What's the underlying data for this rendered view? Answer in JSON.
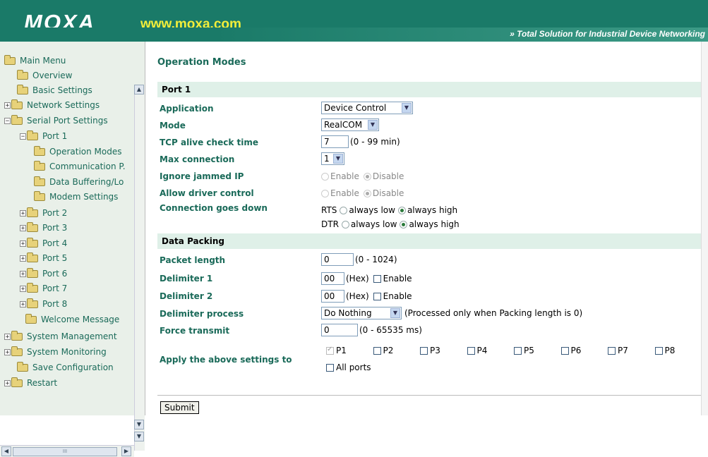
{
  "header": {
    "logo": "MOXA",
    "site": "www.moxa.com",
    "slogan": "» Total Solution for Industrial Device Networking"
  },
  "tree": {
    "items": [
      {
        "label": "Main Menu",
        "icon": "folder-open-icon",
        "expander": ""
      },
      {
        "label": "Overview",
        "icon": "folder-icon",
        "expander": ""
      },
      {
        "label": "Basic Settings",
        "icon": "folder-icon",
        "expander": ""
      },
      {
        "label": "Network Settings",
        "icon": "folder-icon",
        "expander": "+"
      },
      {
        "label": "Serial Port Settings",
        "icon": "folder-open-icon",
        "expander": "−"
      },
      {
        "label": "Port 1",
        "icon": "folder-open-icon",
        "expander": "−"
      },
      {
        "label": "Operation Modes",
        "icon": "folder-icon",
        "expander": ""
      },
      {
        "label": "Communication P.",
        "icon": "folder-icon",
        "expander": ""
      },
      {
        "label": "Data Buffering/Lo",
        "icon": "folder-icon",
        "expander": ""
      },
      {
        "label": "Modem Settings",
        "icon": "folder-icon",
        "expander": ""
      },
      {
        "label": "Port 2",
        "icon": "folder-icon",
        "expander": "+"
      },
      {
        "label": "Port 3",
        "icon": "folder-icon",
        "expander": "+"
      },
      {
        "label": "Port 4",
        "icon": "folder-icon",
        "expander": "+"
      },
      {
        "label": "Port 5",
        "icon": "folder-icon",
        "expander": "+"
      },
      {
        "label": "Port 6",
        "icon": "folder-icon",
        "expander": "+"
      },
      {
        "label": "Port 7",
        "icon": "folder-icon",
        "expander": "+"
      },
      {
        "label": "Port 8",
        "icon": "folder-icon",
        "expander": "+"
      },
      {
        "label": "Welcome Message",
        "icon": "folder-icon",
        "expander": ""
      },
      {
        "label": "System Management",
        "icon": "folder-icon",
        "expander": "+"
      },
      {
        "label": "System Monitoring",
        "icon": "folder-icon",
        "expander": "+"
      },
      {
        "label": "Save Configuration",
        "icon": "folder-icon",
        "expander": ""
      },
      {
        "label": "Restart",
        "icon": "folder-icon",
        "expander": "+"
      }
    ],
    "scroll_thumb_glyph": "III"
  },
  "page": {
    "title": "Operation Modes",
    "port_section": "Port 1",
    "application": {
      "label": "Application",
      "value": "Device Control"
    },
    "mode": {
      "label": "Mode",
      "value": "RealCOM"
    },
    "tcp_alive": {
      "label": "TCP alive check time",
      "value": "7",
      "hint": "(0 - 99 min)"
    },
    "max_connection": {
      "label": "Max connection",
      "value": "1"
    },
    "ignore_jammed": {
      "label": "Ignore jammed IP",
      "enable": "Enable",
      "disable": "Disable",
      "selected": "Disable"
    },
    "allow_driver": {
      "label": "Allow driver control",
      "enable": "Enable",
      "disable": "Disable",
      "selected": "Disable"
    },
    "conn_down": {
      "label": "Connection goes down",
      "rts": "RTS",
      "dtr": "DTR",
      "low": "always low",
      "high": "always high",
      "rts_selected": "always high",
      "dtr_selected": "always high"
    },
    "packing_section": "Data Packing",
    "packet_length": {
      "label": "Packet length",
      "value": "0",
      "hint": "(0 - 1024)"
    },
    "delimiter1": {
      "label": "Delimiter 1",
      "value": "00",
      "hex": "(Hex)",
      "enable": "Enable",
      "checked": false
    },
    "delimiter2": {
      "label": "Delimiter 2",
      "value": "00",
      "hex": "(Hex)",
      "enable": "Enable",
      "checked": false
    },
    "delimiter_process": {
      "label": "Delimiter process",
      "value": "Do Nothing",
      "hint": "(Processed only when Packing length is 0)"
    },
    "force_transmit": {
      "label": "Force transmit",
      "value": "0",
      "hint": "(0 - 65535 ms)"
    },
    "apply": {
      "label": "Apply the above settings to",
      "ports": [
        {
          "label": "P1",
          "checked": true,
          "disabled": true
        },
        {
          "label": "P2",
          "checked": false
        },
        {
          "label": "P3",
          "checked": false
        },
        {
          "label": "P4",
          "checked": false
        },
        {
          "label": "P5",
          "checked": false
        },
        {
          "label": "P6",
          "checked": false
        },
        {
          "label": "P7",
          "checked": false
        },
        {
          "label": "P8",
          "checked": false
        }
      ],
      "all_ports": "All ports"
    },
    "submit": "Submit"
  },
  "colors": {
    "brand": "#1a7a68",
    "label": "#1a6a59",
    "section_bg": "#dff0e8",
    "site": "#f2ee3a"
  }
}
